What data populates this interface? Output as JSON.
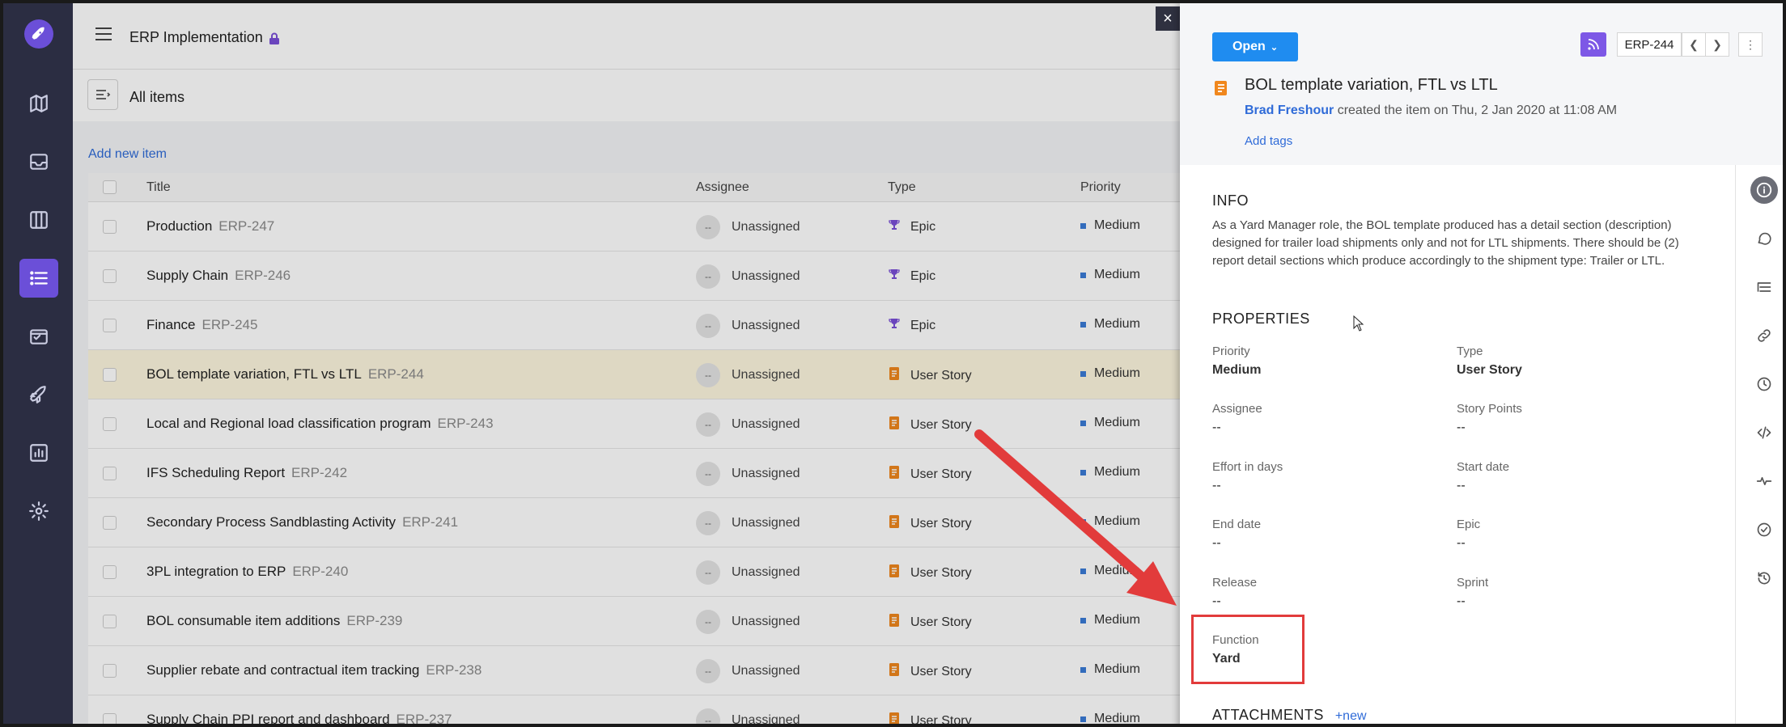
{
  "app": {
    "project_title": "ERP Implementation",
    "view_title": "All items",
    "add_new_item": "Add new item"
  },
  "rail": {
    "items": [
      {
        "name": "roadmap-icon"
      },
      {
        "name": "inbox-icon"
      },
      {
        "name": "board-icon"
      },
      {
        "name": "list-icon",
        "active": true
      },
      {
        "name": "backlog-icon"
      },
      {
        "name": "release-icon"
      },
      {
        "name": "reports-icon"
      },
      {
        "name": "settings-icon"
      }
    ]
  },
  "table": {
    "headers": {
      "title": "Title",
      "assignee": "Assignee",
      "type": "Type",
      "priority": "Priority"
    },
    "rows": [
      {
        "title": "Production",
        "key": "ERP-247",
        "assignee": "Unassigned",
        "avatar": "--",
        "type": "Epic",
        "priority": "Medium"
      },
      {
        "title": "Supply Chain",
        "key": "ERP-246",
        "assignee": "Unassigned",
        "avatar": "--",
        "type": "Epic",
        "priority": "Medium"
      },
      {
        "title": "Finance",
        "key": "ERP-245",
        "assignee": "Unassigned",
        "avatar": "--",
        "type": "Epic",
        "priority": "Medium"
      },
      {
        "title": "BOL template variation, FTL vs LTL",
        "key": "ERP-244",
        "assignee": "Unassigned",
        "avatar": "--",
        "type": "User Story",
        "priority": "Medium",
        "selected": true
      },
      {
        "title": "Local and Regional load classification program",
        "key": "ERP-243",
        "assignee": "Unassigned",
        "avatar": "--",
        "type": "User Story",
        "priority": "Medium"
      },
      {
        "title": "IFS Scheduling Report",
        "key": "ERP-242",
        "assignee": "Unassigned",
        "avatar": "--",
        "type": "User Story",
        "priority": "Medium"
      },
      {
        "title": "Secondary Process Sandblasting Activity",
        "key": "ERP-241",
        "assignee": "Unassigned",
        "avatar": "--",
        "type": "User Story",
        "priority": "Medium"
      },
      {
        "title": "3PL integration to ERP",
        "key": "ERP-240",
        "assignee": "Unassigned",
        "avatar": "--",
        "type": "User Story",
        "priority": "Medium"
      },
      {
        "title": "BOL consumable item additions",
        "key": "ERP-239",
        "assignee": "Unassigned",
        "avatar": "--",
        "type": "User Story",
        "priority": "Medium"
      },
      {
        "title": "Supplier rebate and contractual item tracking",
        "key": "ERP-238",
        "assignee": "Unassigned",
        "avatar": "--",
        "type": "User Story",
        "priority": "Medium"
      },
      {
        "title": "Supply Chain PPI report and dashboard",
        "key": "ERP-237",
        "assignee": "Unassigned",
        "avatar": "--",
        "type": "User Story",
        "priority": "Medium"
      }
    ]
  },
  "detail": {
    "close_label": "×",
    "status": "Open",
    "key": "ERP-244",
    "title": "BOL template variation, FTL vs LTL",
    "creator": "Brad Freshour",
    "created_text": " created the item on Thu, 2 Jan 2020 at 11:08 AM",
    "add_tags": "Add tags",
    "info_heading": "INFO",
    "info_text": "As a Yard Manager role, the BOL template produced has a detail section (description) designed for trailer load shipments only and not for LTL shipments. There should be (2) report detail sections which produce accordingly to the shipment type: Trailer or LTL.",
    "properties_heading": "PROPERTIES",
    "properties": {
      "priority": {
        "label": "Priority",
        "value": "Medium"
      },
      "type": {
        "label": "Type",
        "value": "User Story"
      },
      "assignee": {
        "label": "Assignee",
        "value": "--"
      },
      "story_points": {
        "label": "Story Points",
        "value": "--"
      },
      "effort": {
        "label": "Effort in days",
        "value": "--"
      },
      "start_date": {
        "label": "Start date",
        "value": "--"
      },
      "end_date": {
        "label": "End date",
        "value": "--"
      },
      "epic": {
        "label": "Epic",
        "value": "--"
      },
      "release": {
        "label": "Release",
        "value": "--"
      },
      "sprint": {
        "label": "Sprint",
        "value": "--"
      },
      "function": {
        "label": "Function",
        "value": "Yard"
      }
    },
    "attachments_heading": "ATTACHMENTS",
    "attachments_new": "+new"
  },
  "colors": {
    "accent": "#6b4fd8",
    "primary_button": "#1f8cf0",
    "annotation": "#e23b3b",
    "story_icon": "#f0871d",
    "epic_icon": "#7a4fd8"
  }
}
